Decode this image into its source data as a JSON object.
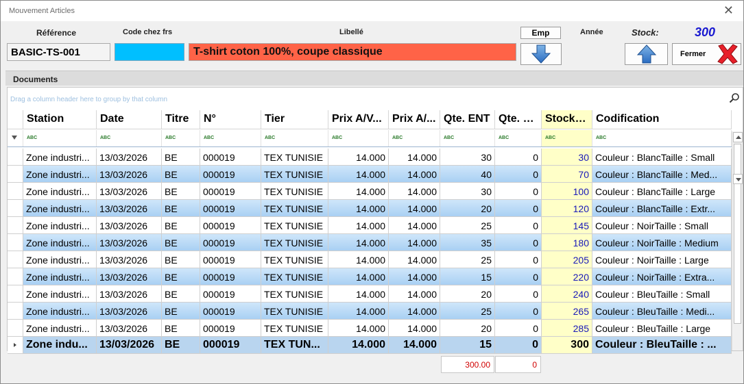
{
  "window": {
    "title": "Mouvement Articles"
  },
  "header": {
    "reference_label": "Référence",
    "code_frs_label": "Code chez frs",
    "libelle_label": "Libellé",
    "annee_label": "Année",
    "stock_label": "Stock:",
    "reference_value": "BASIC-TS-001",
    "code_frs_value": "",
    "libelle_value": "T-shirt coton 100%, coupe classique",
    "stock_value": "300",
    "emp_label": "Emp",
    "fermer_label": "Fermer"
  },
  "colors": {
    "code_frs_bg": "#00bfff",
    "libelle_bg": "#ff6347",
    "stock_col_bg": "#ffffc8",
    "stock_value": "#1818d0",
    "total_text": "#d00000"
  },
  "documents": {
    "group_title": "Documents",
    "group_hint": "Drag a column header here to group by that column",
    "columns": [
      "Station",
      "Date",
      "Titre",
      "N°",
      "Tier",
      "Prix A/V...",
      "Prix A/...",
      "Qte. ENT",
      "Qte. S...",
      "Stock.St",
      "Codification"
    ],
    "sorted_column": "Date",
    "rows": [
      [
        "Zone industri...",
        "13/03/2026",
        "BE",
        "000019",
        "TEX TUNISIE",
        "14.000",
        "14.000",
        "30",
        "0",
        "30",
        "Couleur  : BlancTaille : Small"
      ],
      [
        "Zone industri...",
        "13/03/2026",
        "BE",
        "000019",
        "TEX TUNISIE",
        "14.000",
        "14.000",
        "40",
        "0",
        "70",
        "Couleur  : BlancTaille : Med..."
      ],
      [
        "Zone industri...",
        "13/03/2026",
        "BE",
        "000019",
        "TEX TUNISIE",
        "14.000",
        "14.000",
        "30",
        "0",
        "100",
        "Couleur  : BlancTaille : Large"
      ],
      [
        "Zone industri...",
        "13/03/2026",
        "BE",
        "000019",
        "TEX TUNISIE",
        "14.000",
        "14.000",
        "20",
        "0",
        "120",
        "Couleur  : BlancTaille :  Extr..."
      ],
      [
        "Zone industri...",
        "13/03/2026",
        "BE",
        "000019",
        "TEX TUNISIE",
        "14.000",
        "14.000",
        "25",
        "0",
        "145",
        "Couleur  : NoirTaille : Small"
      ],
      [
        "Zone industri...",
        "13/03/2026",
        "BE",
        "000019",
        "TEX TUNISIE",
        "14.000",
        "14.000",
        "35",
        "0",
        "180",
        "Couleur  : NoirTaille : Medium"
      ],
      [
        "Zone industri...",
        "13/03/2026",
        "BE",
        "000019",
        "TEX TUNISIE",
        "14.000",
        "14.000",
        "25",
        "0",
        "205",
        "Couleur  : NoirTaille : Large"
      ],
      [
        "Zone industri...",
        "13/03/2026",
        "BE",
        "000019",
        "TEX TUNISIE",
        "14.000",
        "14.000",
        "15",
        "0",
        "220",
        "Couleur  : NoirTaille :  Extra..."
      ],
      [
        "Zone industri...",
        "13/03/2026",
        "BE",
        "000019",
        "TEX TUNISIE",
        "14.000",
        "14.000",
        "20",
        "0",
        "240",
        "Couleur  : BleuTaille : Small"
      ],
      [
        "Zone industri...",
        "13/03/2026",
        "BE",
        "000019",
        "TEX TUNISIE",
        "14.000",
        "14.000",
        "25",
        "0",
        "265",
        "Couleur  : BleuTaille : Medi..."
      ],
      [
        "Zone industri...",
        "13/03/2026",
        "BE",
        "000019",
        "TEX TUNISIE",
        "14.000",
        "14.000",
        "20",
        "0",
        "285",
        "Couleur  : BleuTaille : Large"
      ],
      [
        "Zone indu...",
        "13/03/2026",
        "BE",
        "000019",
        "TEX TUN...",
        "14.000",
        "14.000",
        "15",
        "0",
        "300",
        "Couleur  : BleuTaille : ..."
      ]
    ],
    "selected_row": 11,
    "totals": {
      "qte_ent": "300.00",
      "qte_sortie": "0"
    }
  }
}
